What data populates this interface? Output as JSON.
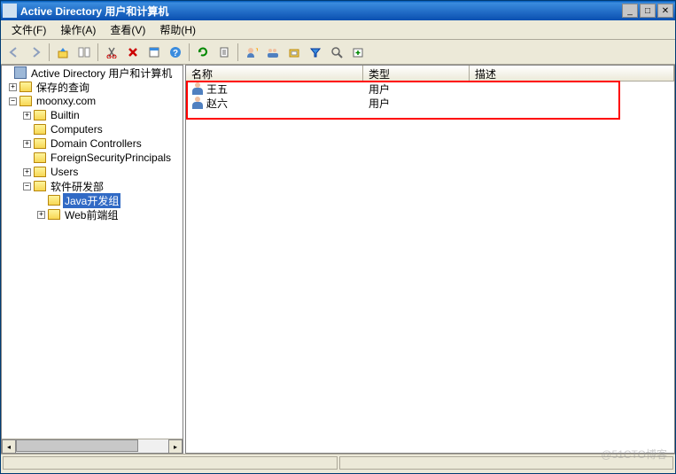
{
  "window": {
    "title": "Active Directory 用户和计算机"
  },
  "menu": {
    "file": "文件(F)",
    "action": "操作(A)",
    "view": "查看(V)",
    "help": "帮助(H)"
  },
  "tree": {
    "root": "Active Directory 用户和计算机",
    "saved": "保存的查询",
    "domain": "moonxy.com",
    "builtin": "Builtin",
    "computers": "Computers",
    "dc": "Domain Controllers",
    "fsp": "ForeignSecurityPrincipals",
    "users": "Users",
    "dept": "软件研发部",
    "java": "Java开发组",
    "web": "Web前端组"
  },
  "columns": {
    "name": "名称",
    "type": "类型",
    "desc": "描述"
  },
  "rows": [
    {
      "name": "王五",
      "type": "用户"
    },
    {
      "name": "赵六",
      "type": "用户"
    }
  ],
  "watermark": "@51CTO博客"
}
